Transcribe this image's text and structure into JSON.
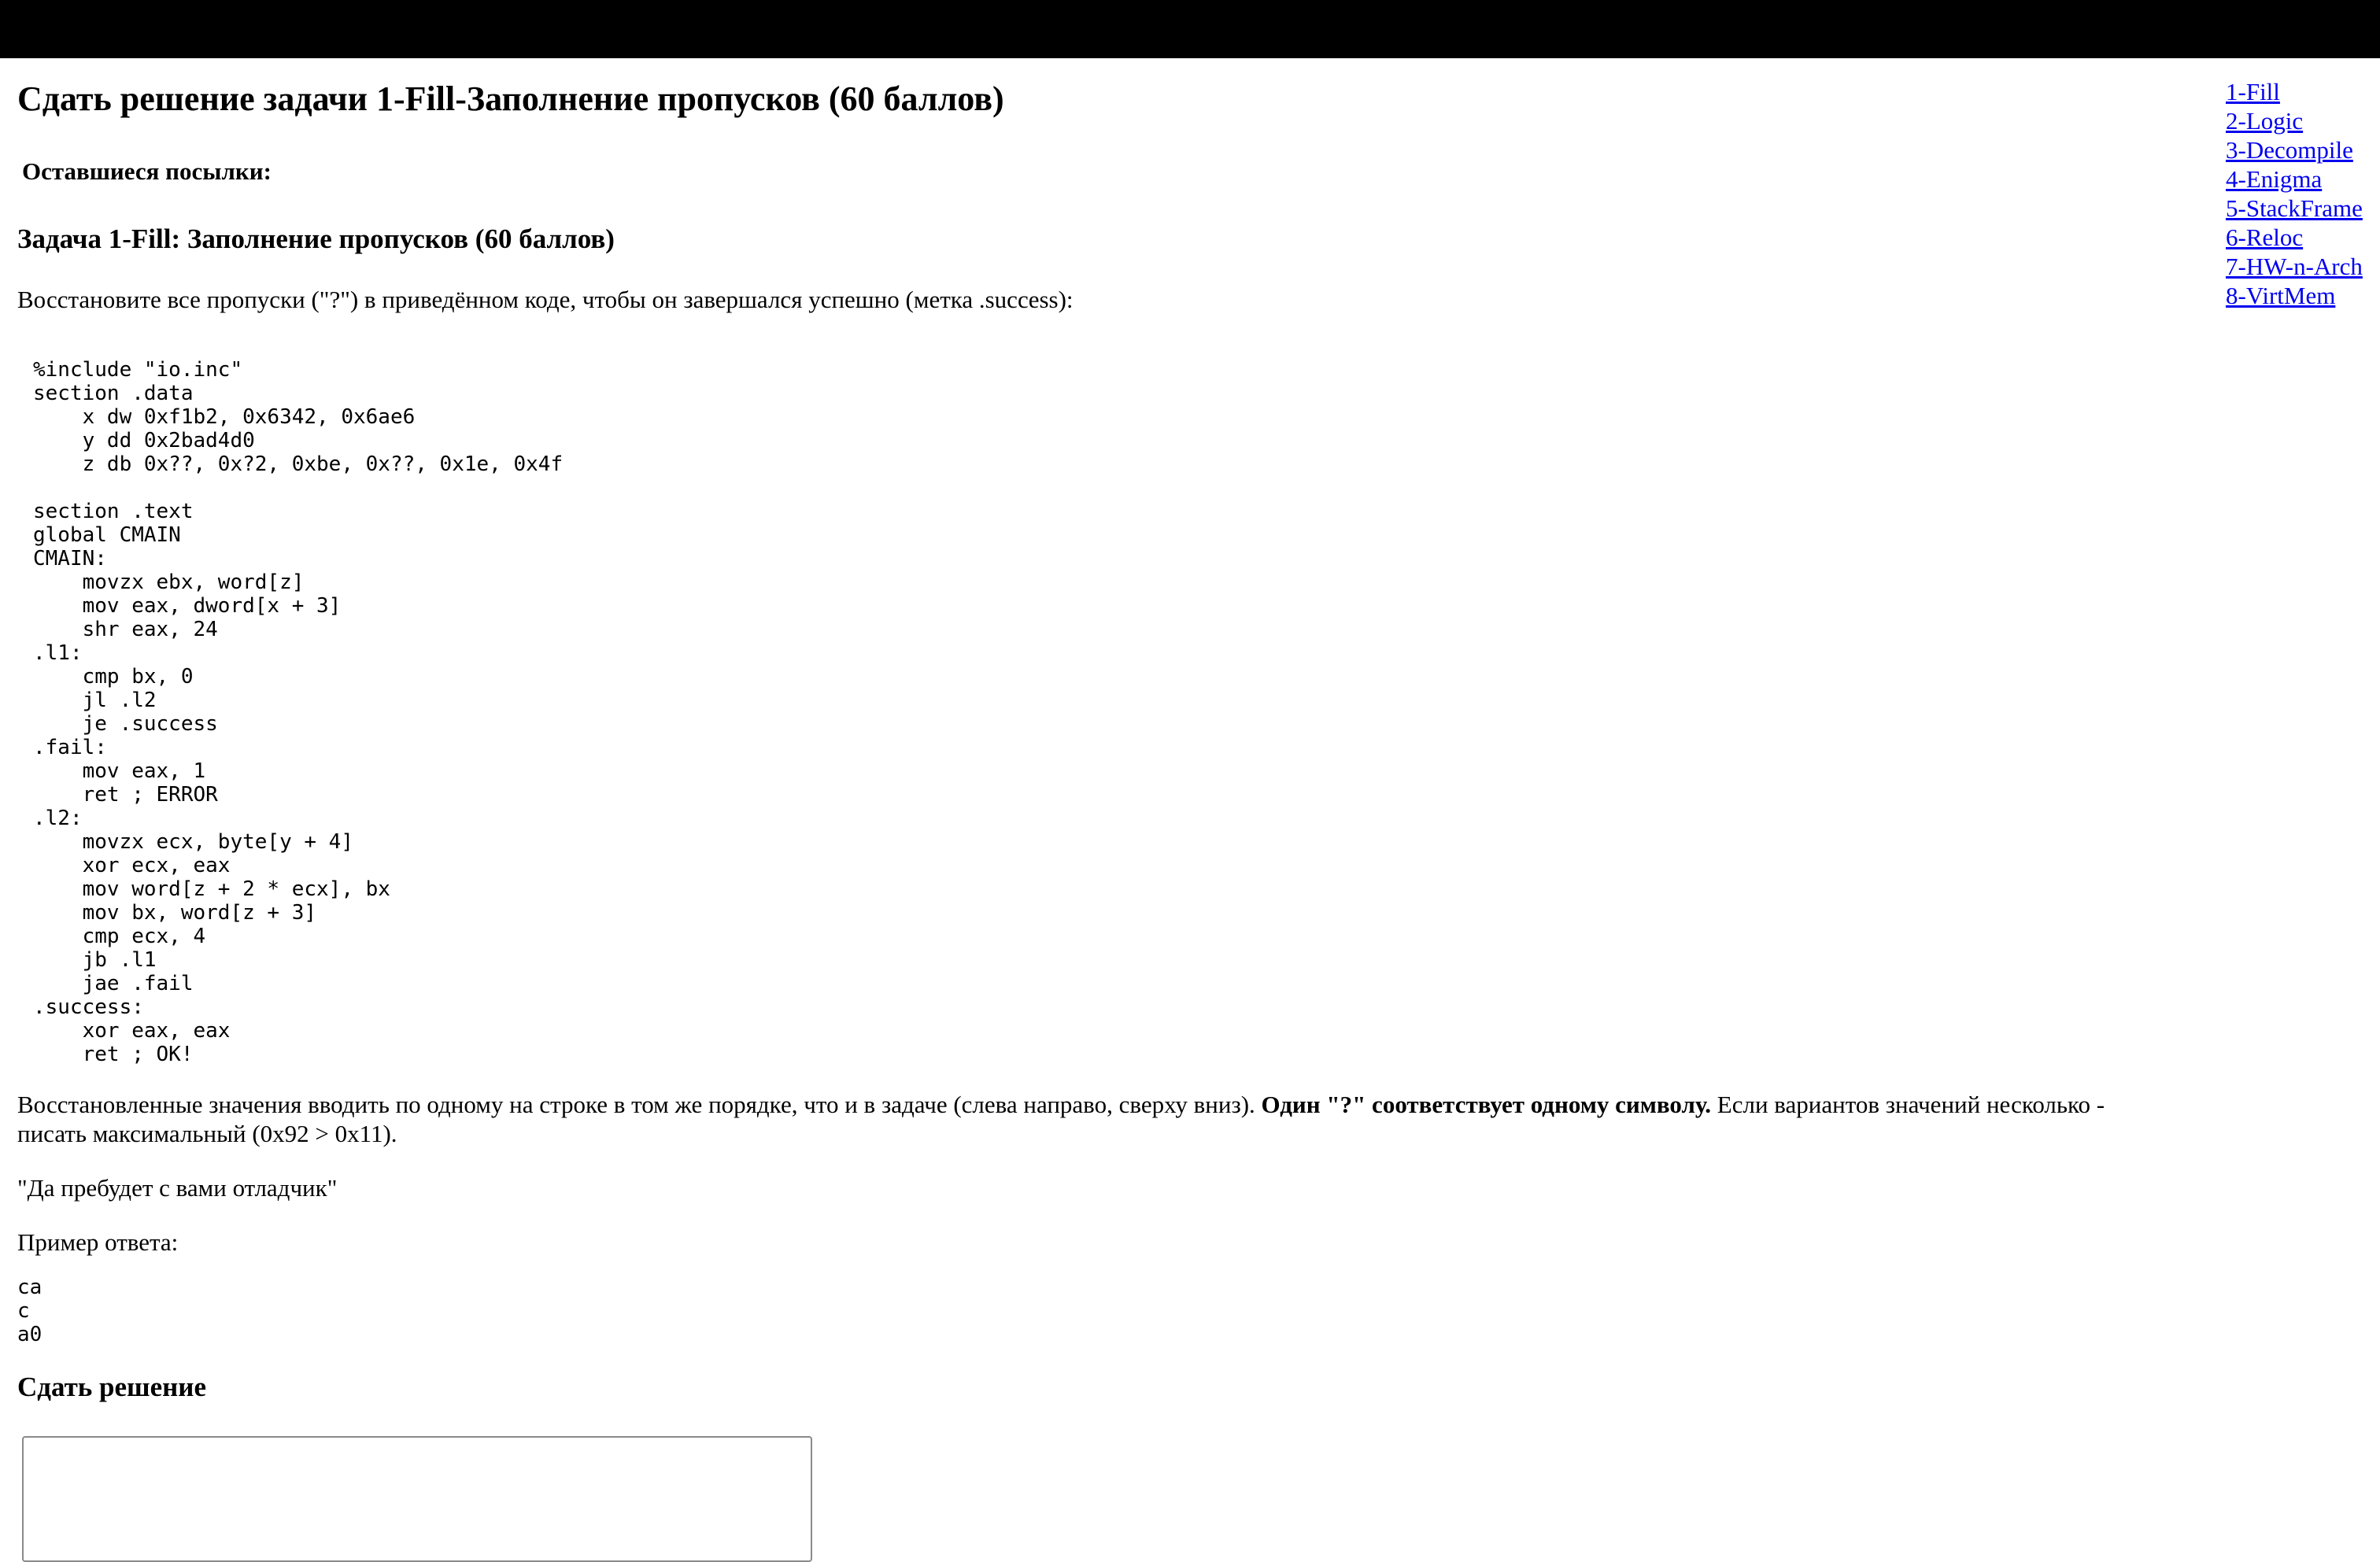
{
  "page": {
    "title": "Сдать решение задачи 1-Fill-Заполнение пропусков (60 баллов)",
    "remaining_label": "Оставшиеся посылки:"
  },
  "task": {
    "heading": "Задача 1-Fill: Заполнение пропусков (60 баллов)",
    "intro": "Восстановите все пропуски (\"?\") в приведённом коде, чтобы он завершался успешно (метка .success):",
    "code": "%include \"io.inc\"\nsection .data\n    x dw 0xf1b2, 0x6342, 0x6ae6\n    y dd 0x2bad4d0\n    z db 0x??, 0x?2, 0xbe, 0x??, 0x1e, 0x4f\n\nsection .text\nglobal CMAIN\nCMAIN:\n    movzx ebx, word[z]\n    mov eax, dword[x + 3]\n    shr eax, 24\n.l1:\n    cmp bx, 0\n    jl .l2\n    je .success\n.fail:\n    mov eax, 1\n    ret ; ERROR\n.l2:\n    movzx ecx, byte[y + 4]\n    xor ecx, eax\n    mov word[z + 2 * ecx], bx\n    mov bx, word[z + 3]\n    cmp ecx, 4\n    jb .l1\n    jae .fail\n.success:\n    xor eax, eax\n    ret ; OK!",
    "instructions_before": "Восстановленные значения вводить по одному на строке в том же порядке, что и в задаче (слева направо, сверху вниз). ",
    "instructions_bold": "Один \"?\" соответствует одному символу.",
    "instructions_after": " Если вариантов значений несколько - писать максимальный (0x92 > 0x11).",
    "quote": "\"Да пребудет с вами отладчик\"",
    "example_label": "Пример ответа:",
    "example": "ca\nc\na0"
  },
  "submit": {
    "heading": "Сдать решение",
    "answer_value": ""
  },
  "nav": {
    "items": [
      {
        "label": "1-Fill"
      },
      {
        "label": "2-Logic"
      },
      {
        "label": "3-Decompile"
      },
      {
        "label": "4-Enigma"
      },
      {
        "label": "5-StackFrame"
      },
      {
        "label": "6-Reloc"
      },
      {
        "label": "7-HW-n-Arch"
      },
      {
        "label": "8-VirtMem"
      }
    ]
  },
  "colors": {
    "topbar": "#000000",
    "link": "#0000ee"
  }
}
